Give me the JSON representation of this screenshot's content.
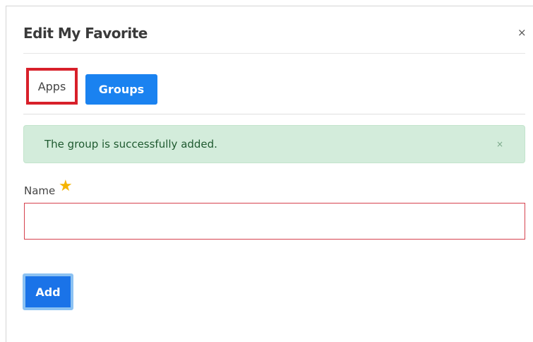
{
  "dialog": {
    "title": "Edit My Favorite",
    "close_glyph": "×"
  },
  "tabs": {
    "apps_label": "Apps",
    "groups_label": "Groups"
  },
  "alert": {
    "message": "The group is successfully added.",
    "close_glyph": "×",
    "color": "#d3ecdb"
  },
  "form": {
    "name_label": "Name",
    "required_marker": "★",
    "name_value": "",
    "name_placeholder": ""
  },
  "actions": {
    "add_label": "Add"
  },
  "colors": {
    "primary": "#1a82f0",
    "highlight_border": "#d8202a",
    "invalid_border": "#d6424e",
    "required_star": "#f5b400"
  }
}
